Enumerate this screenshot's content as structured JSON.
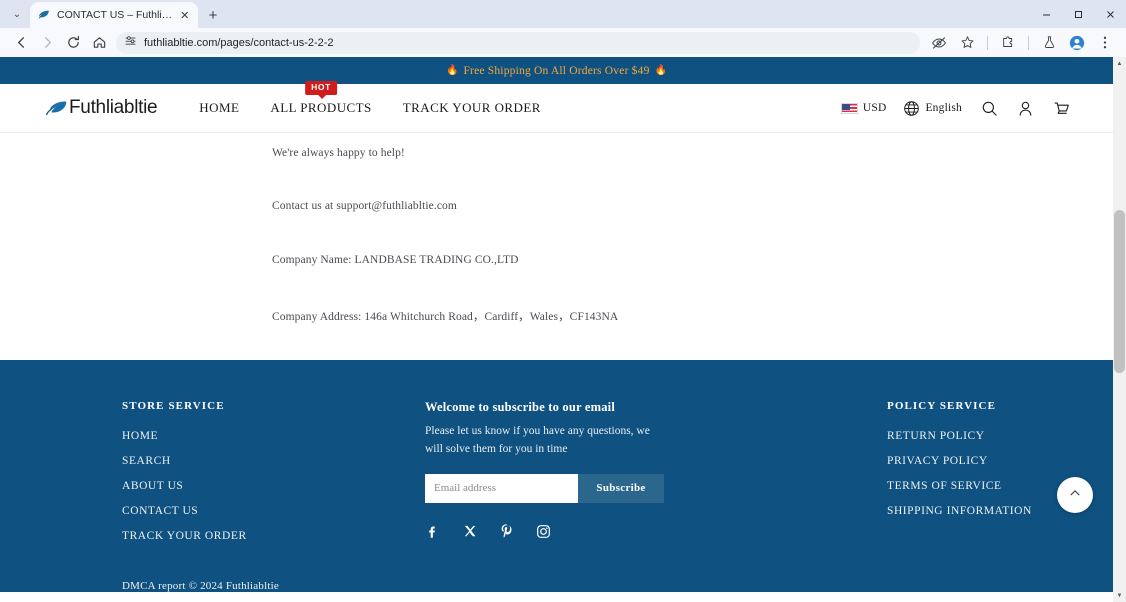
{
  "browser": {
    "tab": {
      "title": "CONTACT US – Futhliabltie",
      "close_label": "✕",
      "favicon": "feather-icon"
    },
    "new_tab_label": "+",
    "tab_list_chevron": "⌄",
    "window_controls": {
      "minimize": "—",
      "maximize": "▢",
      "close": "✕"
    },
    "nav": {
      "back": "←",
      "forward": "→",
      "reload": "⟳",
      "home": "⌂"
    },
    "omnibox": {
      "url": "futhliabltie.com/pages/contact-us-2-2-2",
      "site_info_icon": "tune-icon"
    },
    "toolbar_right": {
      "eye_icon": "eye-slash-icon",
      "bookmark_icon": "star-icon",
      "extensions_icon": "puzzle-icon",
      "labs_icon": "flask-icon",
      "profile_icon": "avatar-icon",
      "menu_icon": "kebab-menu-icon"
    }
  },
  "announcement": {
    "left_flame": "🔥",
    "text": "Free Shipping On All Orders Over $49",
    "right_flame": "🔥",
    "bg": "#0f5180",
    "color": "#f4a83a"
  },
  "header": {
    "logo_text": "Futhliabltie",
    "nav": [
      {
        "label": "HOME",
        "badge": null
      },
      {
        "label": "ALL PRODUCTS",
        "badge": "HOT"
      },
      {
        "label": "TRACK YOUR ORDER",
        "badge": null
      }
    ],
    "currency": "USD",
    "language": "English",
    "icons": {
      "search": "search-icon",
      "account": "user-icon",
      "cart": "cart-icon",
      "globe": "globe-icon",
      "flag": "us-flag-icon"
    }
  },
  "main": {
    "lines": [
      "We're always happy to help!",
      "Contact us at support@futhliabltie.com",
      "Company Name: LANDBASE TRADING CO.,LTD",
      "Company Address: 146a Whitchurch Road，Cardiff，Wales，CF143NA"
    ]
  },
  "footer": {
    "bg": "#0f5180",
    "store": {
      "title": "STORE SERVICE",
      "links": [
        "HOME",
        "SEARCH",
        "ABOUT US",
        "CONTACT US",
        "TRACK YOUR ORDER"
      ]
    },
    "newsletter": {
      "title": "Welcome to subscribe to our email",
      "description": "Please let us know if you have any questions, we will solve them for you in time",
      "email_placeholder": "Email address",
      "email_value": "",
      "subscribe_label": "Subscribe",
      "socials": [
        "facebook-icon",
        "x-twitter-icon",
        "pinterest-icon",
        "instagram-icon"
      ]
    },
    "policy": {
      "title": "POLICY SERVICE",
      "links": [
        "RETURN POLICY",
        "PRIVACY POLICY",
        "TERMS OF SERVICE",
        "SHIPPING INFORMATION"
      ]
    },
    "copyright": "DMCA report © 2024 Futhliabltie",
    "back_to_top_icon": "chevron-up-icon"
  },
  "scrollbar": {
    "up_arrow": "▲",
    "down_arrow": "▼"
  }
}
